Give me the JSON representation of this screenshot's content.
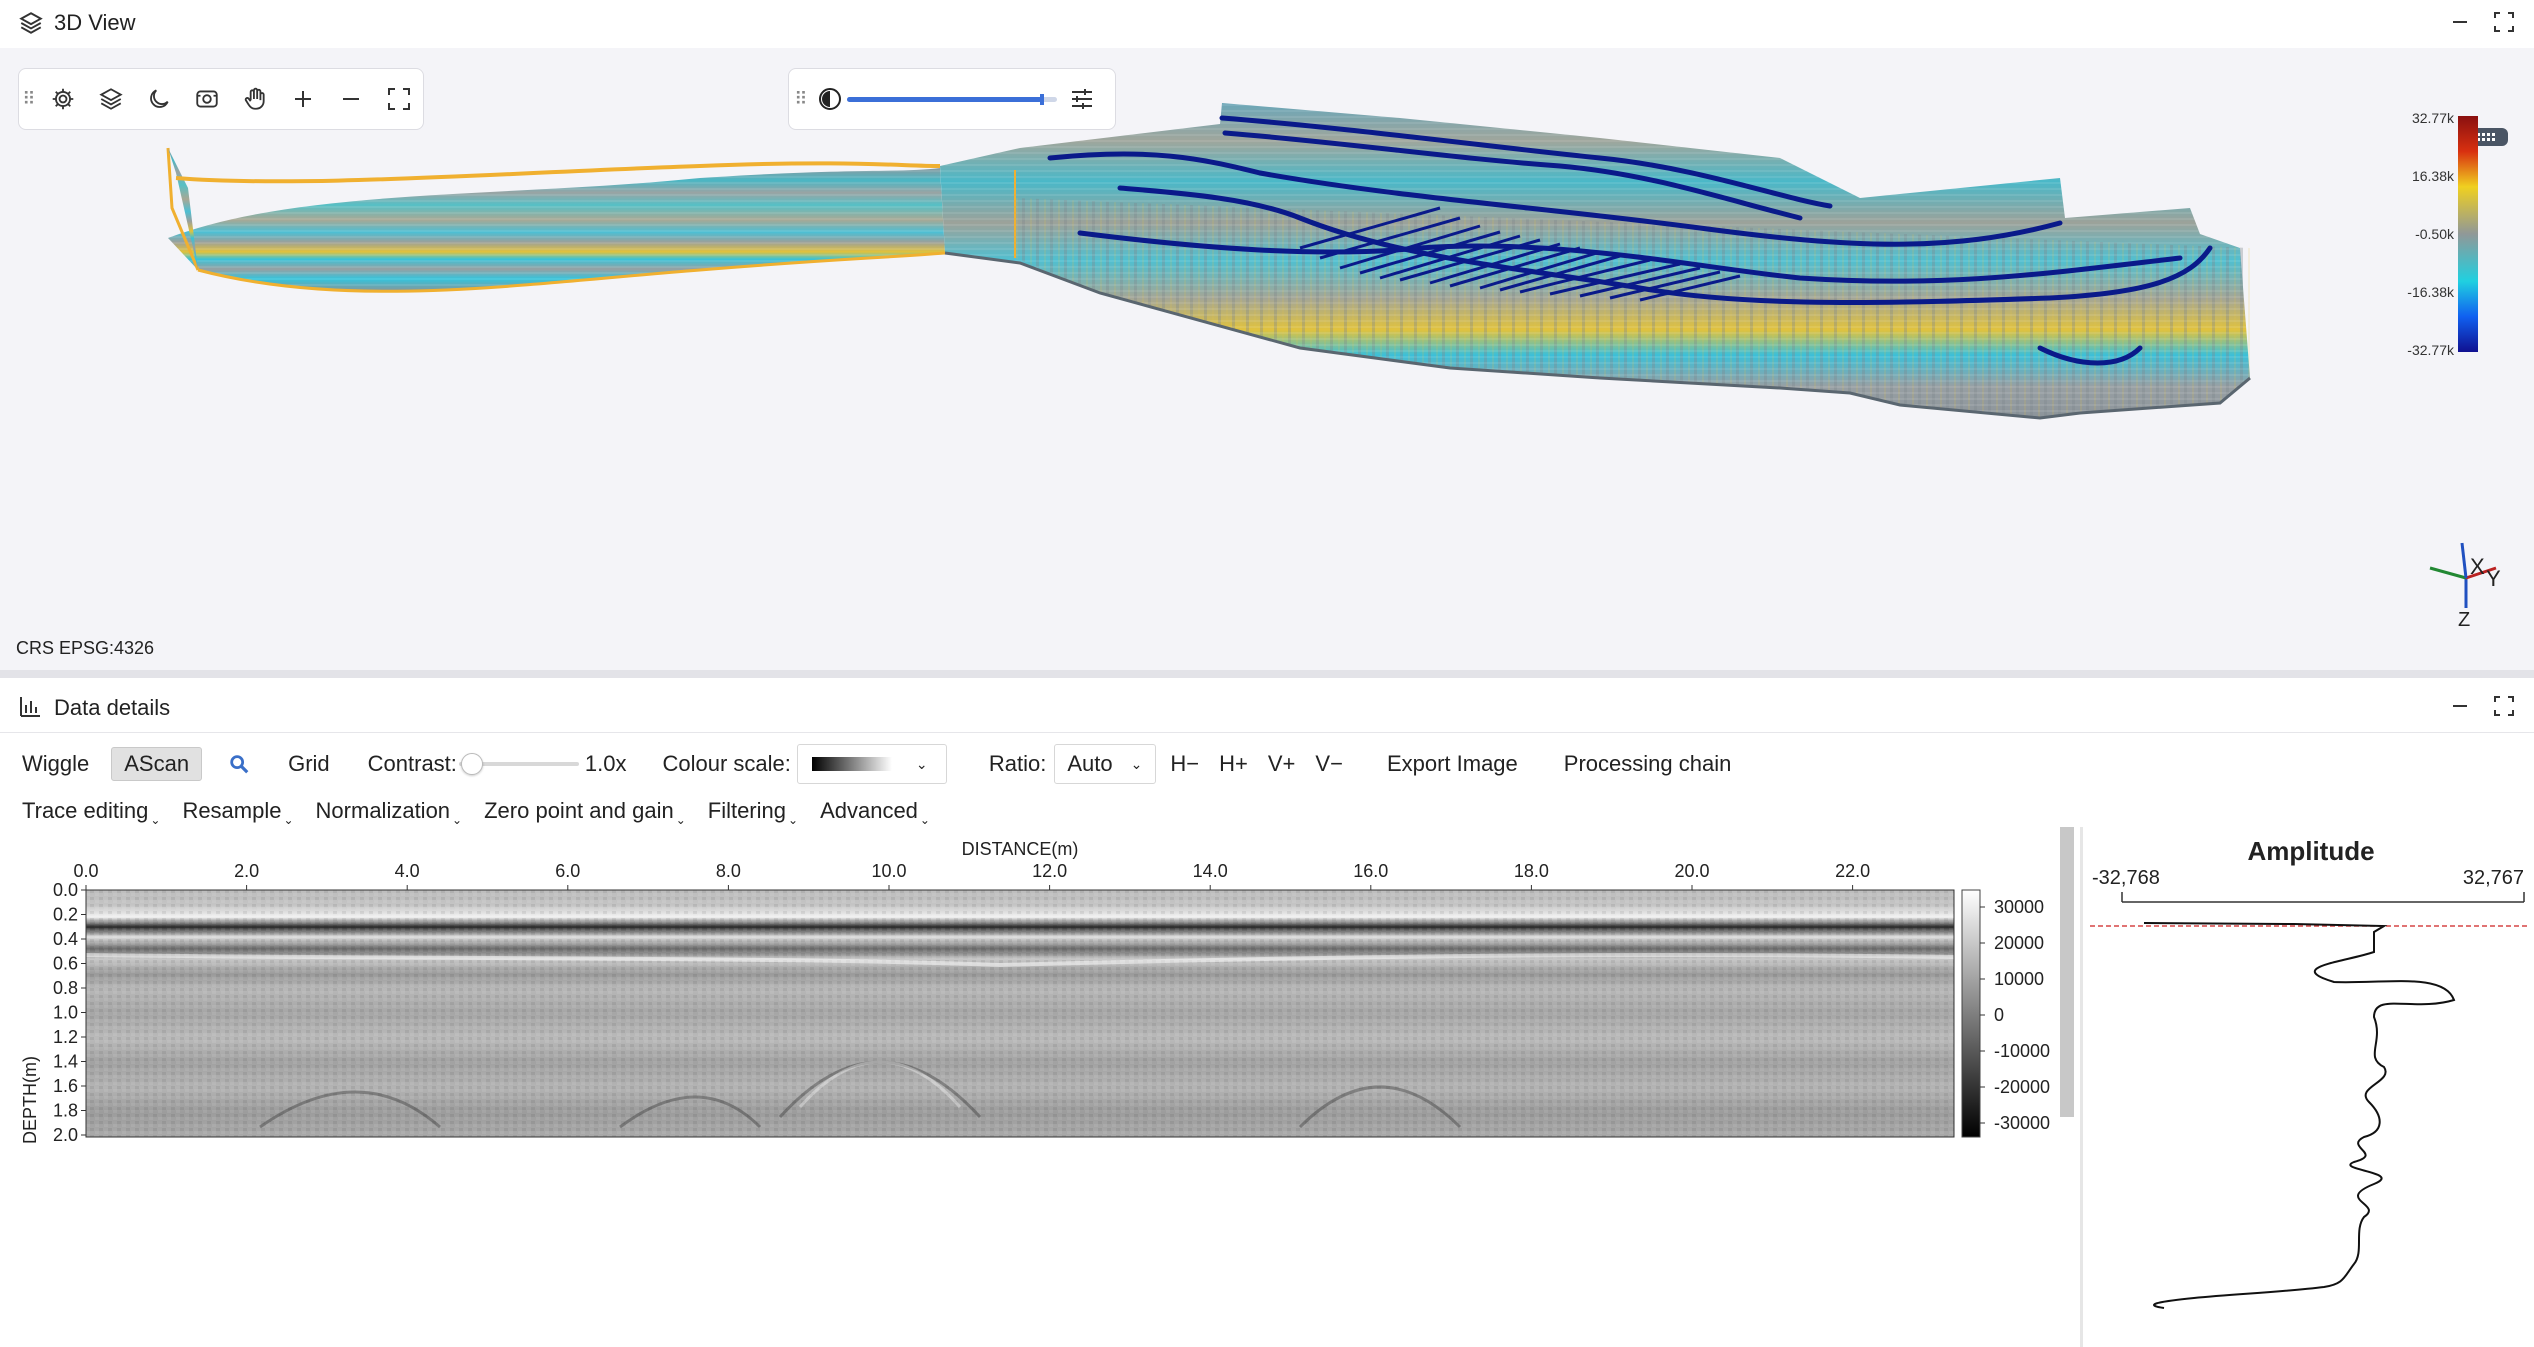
{
  "view3d": {
    "title": "3D View",
    "crs": "CRS EPSG:4326",
    "colorbar": {
      "ticks": [
        "32.77k",
        "16.38k",
        "-0.50k",
        "-16.38k",
        "-32.77k"
      ]
    },
    "toolbar_icons": [
      "settings-icon",
      "layers-icon",
      "moon-icon",
      "camera-icon",
      "hand-icon",
      "zoom-in-icon",
      "zoom-out-icon",
      "fullscreen-icon"
    ],
    "axes_widget": {
      "x": "X",
      "y": "Y",
      "z": "Z"
    },
    "opacity_level": 0.93
  },
  "details": {
    "title": "Data details",
    "toolbar": {
      "wiggle": "Wiggle",
      "ascan": "AScan",
      "grid": "Grid",
      "contrast_label": "Contrast:",
      "contrast_value": "1.0x",
      "colour_scale_label": "Colour scale:",
      "ratio_label": "Ratio:",
      "ratio_value": "Auto",
      "h_minus": "H−",
      "h_plus": "H+",
      "v_plus": "V+",
      "v_minus": "V−",
      "export_image": "Export Image",
      "processing_chain": "Processing chain"
    },
    "menus": [
      "Trace editing",
      "Resample",
      "Normalization",
      "Zero point and gain",
      "Filtering",
      "Advanced"
    ],
    "radargram": {
      "x_label": "DISTANCE(m)",
      "y_label": "DEPTH(m)",
      "x_ticks": [
        "0.0",
        "2.0",
        "4.0",
        "6.0",
        "8.0",
        "10.0",
        "12.0",
        "14.0",
        "16.0",
        "18.0",
        "20.0",
        "22.0"
      ],
      "y_ticks": [
        "0.0",
        "0.2",
        "0.4",
        "0.6",
        "0.8",
        "1.0",
        "1.2",
        "1.4",
        "1.6",
        "1.8",
        "2.0"
      ],
      "colorbar_ticks": [
        "30000",
        "20000",
        "10000",
        "0",
        "-10000",
        "-20000",
        "-30000"
      ]
    },
    "amplitude": {
      "title": "Amplitude",
      "min": "-32,768",
      "max": "32,767"
    }
  }
}
